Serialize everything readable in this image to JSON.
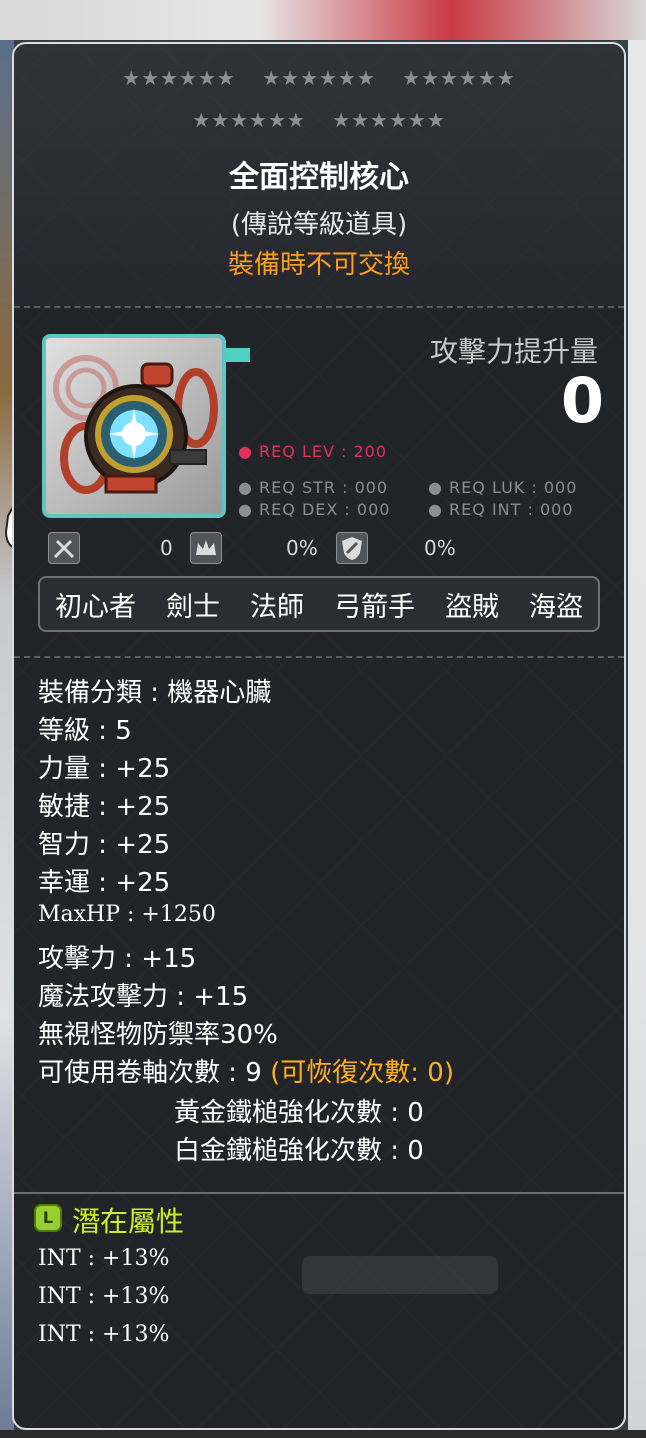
{
  "tooltip": {
    "stars_row1": [
      "★★★★★★",
      "★★★★★★",
      "★★★★★★"
    ],
    "stars_row2": [
      "★★★★★★",
      "★★★★★★"
    ],
    "item_name": "全面控制核心",
    "grade": "(傳說等級道具)",
    "trade_note": "裝備時不可交換",
    "attack_increase_label": "攻擊力提升量",
    "attack_increase_value": "0",
    "req_level": "● REQ LEV : 200",
    "req_str": "● REQ STR : 000",
    "req_luk": "● REQ LUK : 000",
    "req_dex": "● REQ DEX : 000",
    "req_int": "● REQ INT : 000",
    "icon_stats": [
      {
        "icon": "swords-icon",
        "value": "0"
      },
      {
        "icon": "crown-icon",
        "value": "0%"
      },
      {
        "icon": "shield-icon",
        "value": "0%"
      }
    ],
    "jobs": [
      "初心者",
      "劍士",
      "法師",
      "弓箭手",
      "盜賊",
      "海盜"
    ],
    "stats": [
      "裝備分類 : 機器心臟",
      "等級 : 5",
      "力量 : +25",
      "敏捷 : +25",
      "智力 : +25",
      "幸運 : +25",
      "MaxHP : +1250",
      "攻擊力 : +15",
      "魔法攻擊力 : +15",
      "無視怪物防禦率30%"
    ],
    "scroll_line": "可使用卷軸次數 : 9",
    "scroll_recover": "(可恢復次數: 0)",
    "gold_hammer": "黃金鐵槌強化次數 : 0",
    "platinum_hammer": "白金鐵槌強化次數 : 0",
    "potential_badge": "L",
    "potential_title": "潛在屬性",
    "potential_lines": [
      "INT : +13%",
      "INT : +13%",
      "INT : +13%"
    ]
  },
  "colors": {
    "legendary_badge": "#9acd32",
    "trade_note": "#ff9d1f",
    "req_level": "#e0335c",
    "potential_title": "#cfee2a",
    "icon_border": "#5ec6c0"
  }
}
